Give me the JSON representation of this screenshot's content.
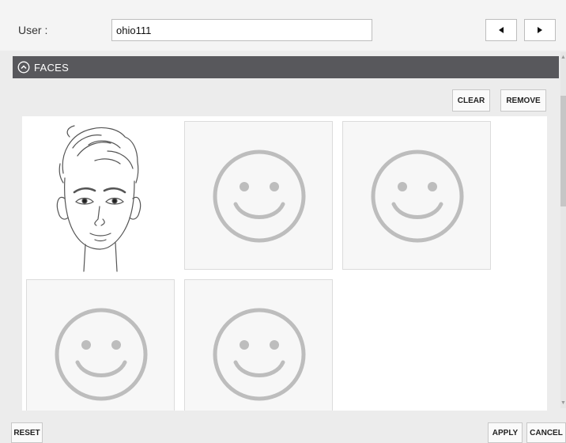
{
  "user": {
    "label": "User :",
    "value": "ohio111"
  },
  "navigation": {
    "prev_icon": "triangle-left-icon",
    "next_icon": "triangle-right-icon"
  },
  "faces": {
    "header": "FACES",
    "collapse_icon": "chevron-up-circle-icon",
    "clear_label": "CLEAR",
    "remove_label": "REMOVE",
    "tiles": [
      {
        "kind": "photo",
        "icon": "face-sketch-image"
      },
      {
        "kind": "placeholder",
        "icon": "smiley-placeholder-icon"
      },
      {
        "kind": "placeholder",
        "icon": "smiley-placeholder-icon"
      },
      {
        "kind": "placeholder",
        "icon": "smiley-placeholder-icon"
      },
      {
        "kind": "placeholder",
        "icon": "smiley-placeholder-icon"
      }
    ]
  },
  "footer": {
    "reset_label": "RESET",
    "apply_label": "APPLY",
    "cancel_label": "CANCEL"
  },
  "colors": {
    "section_header_bg": "#58585c",
    "placeholder_stroke": "#bdbdbd",
    "tile_border": "#dcdcdc"
  }
}
